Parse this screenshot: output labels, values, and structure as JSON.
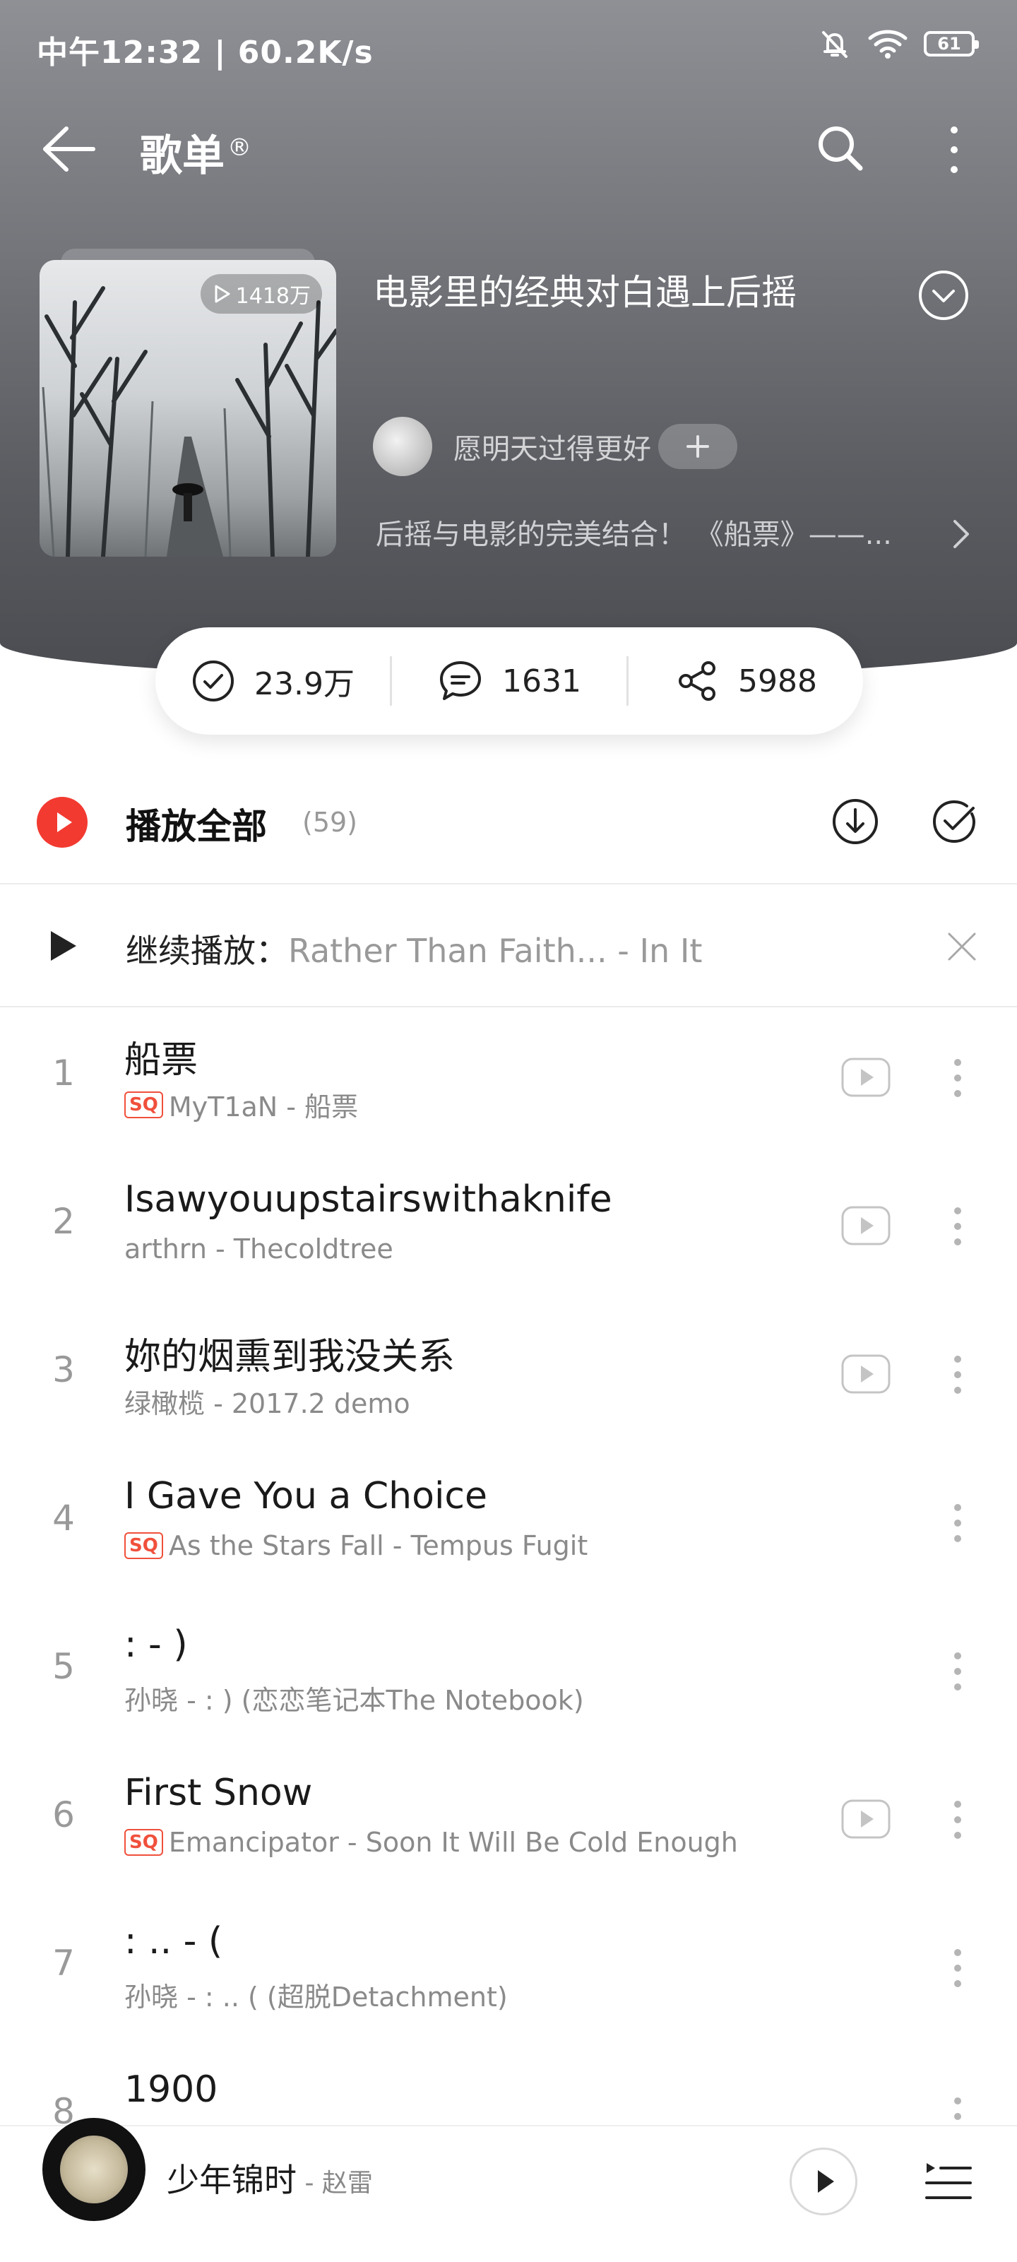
{
  "status_bar": {
    "left_text": "中午12:32 | 60.2K/s",
    "battery": "61"
  },
  "topbar": {
    "title": "歌单",
    "title_mark": "®"
  },
  "playlist": {
    "play_count": "1418万",
    "title": "电影里的经典对白遇上后摇",
    "creator": "愿明天过得更好",
    "description": "后摇与电影的完美结合！ 《船票》——...",
    "likes": "23.9万",
    "comments": "1631",
    "shares": "5988"
  },
  "play_all": {
    "label": "播放全部",
    "count": "(59)"
  },
  "resume": {
    "label": "继续播放：",
    "track": "Rather Than Faith... - In It"
  },
  "songs": [
    {
      "index": "1",
      "title": "船票",
      "sq": true,
      "subtitle": "MyT1aN - 船票",
      "mv": true
    },
    {
      "index": "2",
      "title": "Isawyouupstairswithaknife",
      "sq": false,
      "subtitle": "arthrn - Thecoldtree",
      "mv": true
    },
    {
      "index": "3",
      "title": "妳的烟熏到我没关系",
      "sq": false,
      "subtitle": "绿橄榄 - 2017.2 demo",
      "mv": true
    },
    {
      "index": "4",
      "title": "I Gave You a Choice",
      "sq": true,
      "subtitle": "As the Stars Fall - Tempus Fugit",
      "mv": false
    },
    {
      "index": "5",
      "title": ": - )",
      "sq": false,
      "subtitle": "孙晓 - :  ) (恋恋笔记本The Notebook)",
      "mv": false
    },
    {
      "index": "6",
      "title": "First Snow",
      "sq": true,
      "subtitle": "Emancipator - Soon It Will Be Cold Enough",
      "mv": true
    },
    {
      "index": "7",
      "title": ":  .. -  (",
      "sq": false,
      "subtitle": "孙晓 - :  ..   ( (超脱Detachment)",
      "mv": false
    },
    {
      "index": "8",
      "title": "1900",
      "sq": false,
      "subtitle": "",
      "mv": false
    }
  ],
  "sq_label": "SQ",
  "mini_player": {
    "title": "少年锦时",
    "artist": " - 赵雷"
  },
  "colors": {
    "accent_red": "#f23a31",
    "sq_red": "#f0503c"
  }
}
